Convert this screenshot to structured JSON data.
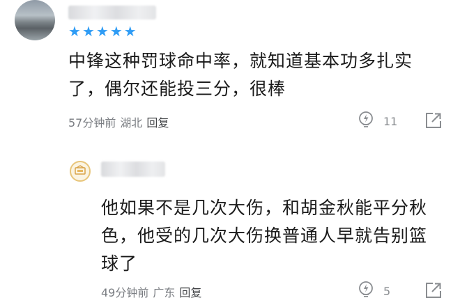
{
  "comments": [
    {
      "rating_stars": 5,
      "text_line1": "中锋这种罚球命中率，就知道基本功多扎实",
      "text_line2": "了，偶尔还能投三分，很棒",
      "time": "57分钟前",
      "location": "湖北",
      "reply_label": "回复",
      "likes": "11",
      "icons": {
        "like": "lightbulb-like-icon",
        "share": "share-icon"
      }
    },
    {
      "text_line1": "他如果不是几次大伤，和胡金秋能平分秋",
      "text_line2": "色，他受的几次大伤换普通人早就告别篮",
      "text_line3": "球了",
      "time": "49分钟前",
      "location": "广东",
      "reply_label": "回复",
      "likes": "5",
      "icons": {
        "like": "lightbulb-like-icon",
        "share": "share-icon",
        "badge": "level-badge-icon"
      }
    }
  ],
  "colors": {
    "star": "#2f9cf5",
    "text": "#1a1a1a",
    "meta": "#7a7d82"
  }
}
